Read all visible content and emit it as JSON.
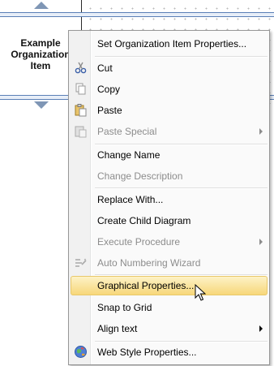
{
  "diagram": {
    "org_item_label": "Example\nOrganization\nItem"
  },
  "menu": {
    "items": [
      {
        "label": "Set Organization Item Properties...",
        "enabled": true,
        "submenu": false,
        "icon": ""
      },
      {
        "label": "Cut",
        "enabled": true,
        "submenu": false,
        "icon": "scissors-icon"
      },
      {
        "label": "Copy",
        "enabled": true,
        "submenu": false,
        "icon": "copy-icon"
      },
      {
        "label": "Paste",
        "enabled": true,
        "submenu": false,
        "icon": "paste-icon"
      },
      {
        "label": "Paste Special",
        "enabled": false,
        "submenu": true,
        "icon": "paste-special-icon"
      },
      {
        "label": "Change Name",
        "enabled": true,
        "submenu": false,
        "icon": ""
      },
      {
        "label": "Change Description",
        "enabled": false,
        "submenu": false,
        "icon": ""
      },
      {
        "label": "Replace With...",
        "enabled": true,
        "submenu": false,
        "icon": ""
      },
      {
        "label": "Create Child Diagram",
        "enabled": true,
        "submenu": false,
        "icon": ""
      },
      {
        "label": "Execute Procedure",
        "enabled": false,
        "submenu": true,
        "icon": ""
      },
      {
        "label": "Auto Numbering Wizard",
        "enabled": false,
        "submenu": false,
        "icon": "auto-numbering-icon"
      },
      {
        "label": "Graphical Properties...",
        "enabled": true,
        "submenu": false,
        "icon": "",
        "highlighted": true
      },
      {
        "label": "Snap to Grid",
        "enabled": true,
        "submenu": false,
        "icon": ""
      },
      {
        "label": "Align text",
        "enabled": true,
        "submenu": true,
        "icon": ""
      },
      {
        "label": "Web Style Properties...",
        "enabled": true,
        "submenu": false,
        "icon": "web-globe-icon"
      }
    ],
    "colors": {
      "highlight_top": "#fdf2c6",
      "highlight_bottom": "#f7d77a",
      "disabled_text": "#8c8c8c"
    }
  }
}
